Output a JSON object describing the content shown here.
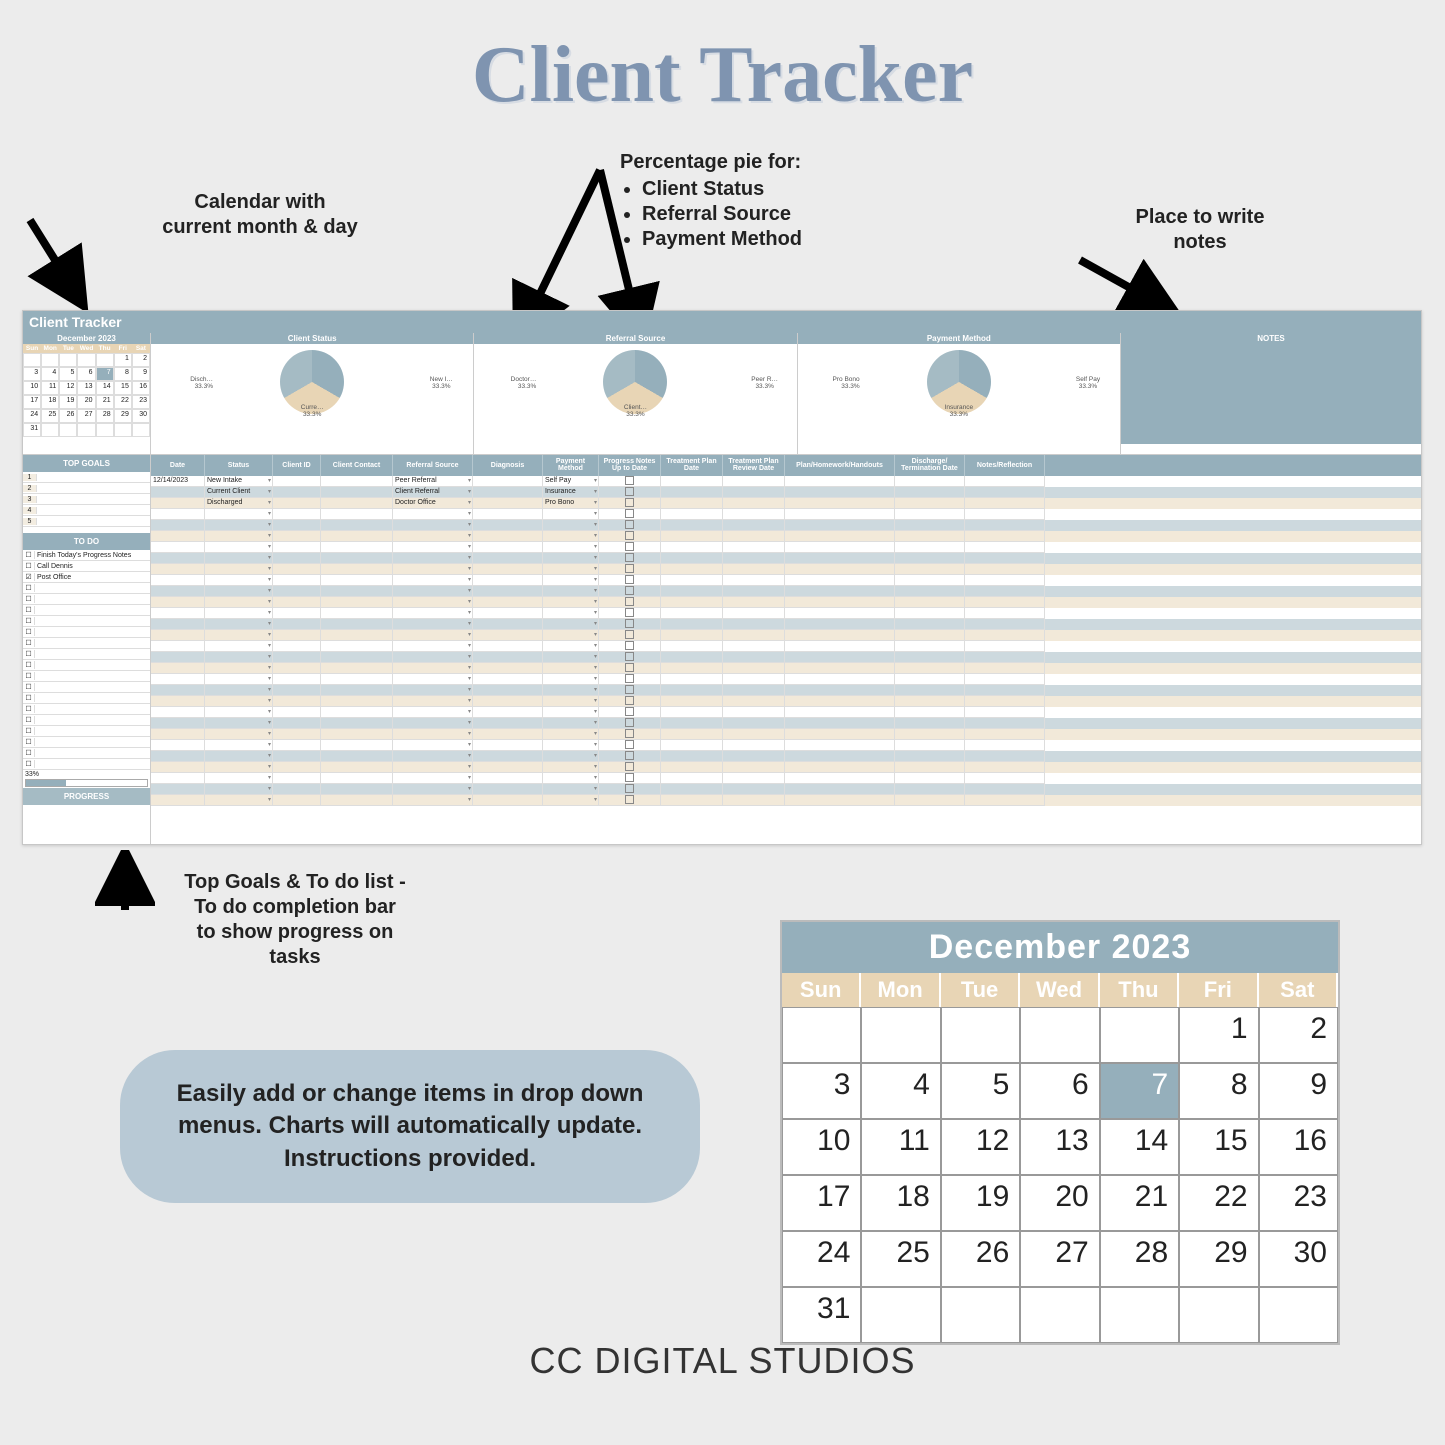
{
  "title": "Client Tracker",
  "annotations": {
    "cal": "Calendar with\ncurrent month & day",
    "pie_hdr": "Percentage pie for:",
    "pie_items": [
      "Client Status",
      "Referral Source",
      "Payment Method"
    ],
    "notes": "Place to write\nnotes",
    "bl": "Top Goals & To do list  -\nTo do  completion bar\nto show progress on\ntasks"
  },
  "sheet": {
    "title": "Client Tracker",
    "calendar": {
      "month_year": "December   2023",
      "days": [
        "Sun",
        "Mon",
        "Tue",
        "Wed",
        "Thu",
        "Fri",
        "Sat"
      ],
      "offset": 5,
      "highlight": 7,
      "last": 31
    },
    "charts": {
      "status": {
        "title": "Client Status",
        "a": "Disch…\n33.3%",
        "b": "New I…\n33.3%",
        "c": "Curre…\n33.3%"
      },
      "referral": {
        "title": "Referral Source",
        "a": "Doctor…\n33.3%",
        "b": "Peer R…\n33.3%",
        "c": "Client…\n33.3%"
      },
      "payment": {
        "title": "Payment Method",
        "a": "Pro Bono\n33.3%",
        "b": "Self Pay\n33.3%",
        "c": "Insurance\n33.3%"
      }
    },
    "notes_title": "NOTES",
    "top_goals_hdr": "TOP GOALS",
    "todo_hdr": "TO DO",
    "todo": [
      {
        "done": false,
        "text": "Finish Today's Progress Notes"
      },
      {
        "done": false,
        "text": "Call Dennis"
      },
      {
        "done": true,
        "text": "Post Office"
      }
    ],
    "progress_pct": "33%",
    "progress_label": "PROGRESS",
    "columns": [
      "Date",
      "Status",
      "Client ID",
      "Client Contact",
      "Referral Source",
      "Diagnosis",
      "Payment Method",
      "Progress Notes Up to Date",
      "Treatment Plan Date",
      "Treatment Plan Review Date",
      "Plan/Homework/Handouts",
      "Discharge/ Termination Date",
      "Notes/Reflection"
    ],
    "rows": [
      {
        "date": "12/14/2023",
        "status": "New Intake",
        "referral": "Peer Referral",
        "payment": "Self Pay"
      },
      {
        "date": "",
        "status": "Current Client",
        "referral": "Client Referral",
        "payment": "Insurance"
      },
      {
        "date": "",
        "status": "Discharged",
        "referral": "Doctor Office",
        "payment": "Pro Bono"
      }
    ]
  },
  "chart_data": [
    {
      "type": "pie",
      "title": "Client Status",
      "series": [
        {
          "name": "Discharged",
          "value": 33.3
        },
        {
          "name": "New Intake",
          "value": 33.3
        },
        {
          "name": "Current Client",
          "value": 33.3
        }
      ]
    },
    {
      "type": "pie",
      "title": "Referral Source",
      "series": [
        {
          "name": "Doctor Office",
          "value": 33.3
        },
        {
          "name": "Peer Referral",
          "value": 33.3
        },
        {
          "name": "Client Referral",
          "value": 33.3
        }
      ]
    },
    {
      "type": "pie",
      "title": "Payment Method",
      "series": [
        {
          "name": "Pro Bono",
          "value": 33.3
        },
        {
          "name": "Self Pay",
          "value": 33.3
        },
        {
          "name": "Insurance",
          "value": 33.3
        }
      ]
    }
  ],
  "big_cal": {
    "month_year": "December   2023",
    "days": [
      "Sun",
      "Mon",
      "Tue",
      "Wed",
      "Thu",
      "Fri",
      "Sat"
    ],
    "offset": 5,
    "highlight": 7,
    "last": 31
  },
  "pill": "Easily add or change items in drop down menus.  Charts will automatically update.  Instructions provided.",
  "footer": "CC DIGITAL STUDIOS"
}
